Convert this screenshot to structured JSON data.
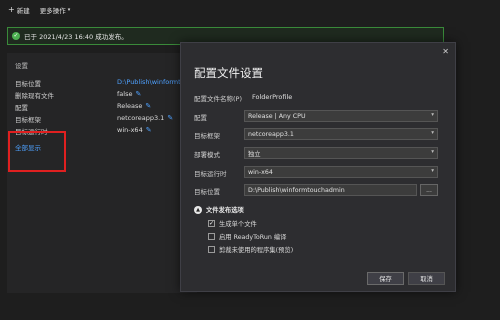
{
  "toolbar": {
    "new_label": "新建",
    "more_label": "更多操作"
  },
  "banner": {
    "text": "已于 2021/4/23 16:40 成功发布。"
  },
  "settings": {
    "title": "设置",
    "rows": [
      {
        "label": "目标位置",
        "value": "D:\\Publish\\winformtouchadmin"
      },
      {
        "label": "删除现有文件",
        "value": "false"
      },
      {
        "label": "配置",
        "value": "Release"
      },
      {
        "label": "目标框架",
        "value": "netcoreapp3.1"
      },
      {
        "label": "目标运行时",
        "value": "win-x64"
      }
    ],
    "show_all": "全部显示"
  },
  "dialog": {
    "title": "配置文件设置",
    "profile_name_label": "配置文件名称(P)",
    "profile_name": "FolderProfile",
    "fields": {
      "config": {
        "label": "配置",
        "value": "Release | Any CPU"
      },
      "framework": {
        "label": "目标框架",
        "value": "netcoreapp3.1"
      },
      "deploy": {
        "label": "部署模式",
        "value": "独立"
      },
      "runtime": {
        "label": "目标运行时",
        "value": "win-x64"
      },
      "location": {
        "label": "目标位置",
        "value": "D:\\Publish\\winformtouchadmin",
        "browse": "..."
      }
    },
    "publish_options": {
      "title": "文件发布选项",
      "options": [
        {
          "label": "生成单个文件",
          "checked": true
        },
        {
          "label": "启用 ReadyToRun 编译",
          "checked": false
        },
        {
          "label": "剪裁未使用的程序集(预览)",
          "checked": false
        }
      ]
    },
    "save": "保存",
    "cancel": "取消"
  },
  "icons": {
    "close": "close-icon",
    "check": "check-circle-icon",
    "pencil": "pencil-icon",
    "collapse": "chevron-up-icon"
  },
  "colors": {
    "accent": "#4ea1ff",
    "success": "#4caf50",
    "highlight": "#e02020"
  }
}
